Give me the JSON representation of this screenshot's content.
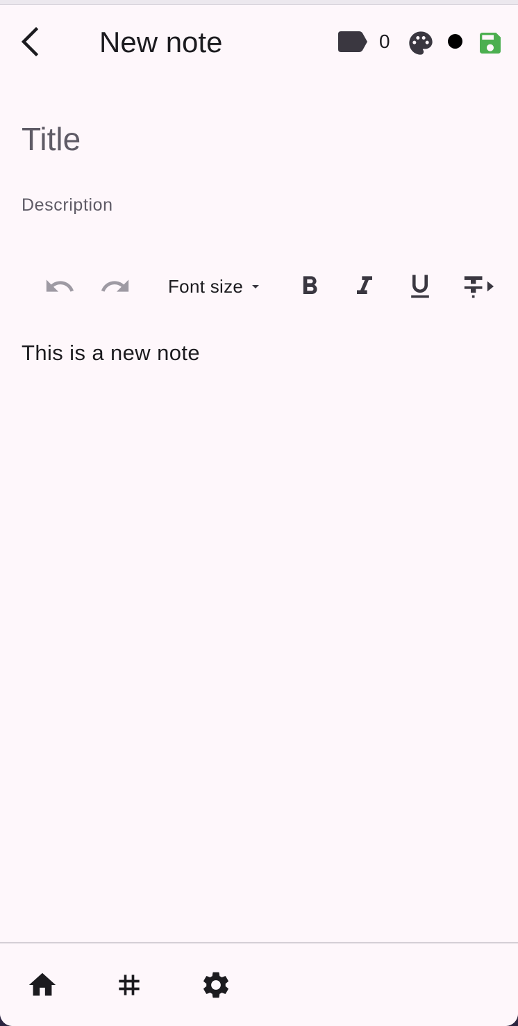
{
  "appbar": {
    "title": "New note",
    "back_icon": "chevron-left-icon",
    "tag_icon": "label-icon",
    "tag_count": "0",
    "palette_icon": "palette-icon",
    "selected_color": "#000000",
    "save_icon": "save-icon",
    "save_color": "#4caf50"
  },
  "fields": {
    "title_placeholder": "Title",
    "title_value": "",
    "description_placeholder": "Description",
    "description_value": ""
  },
  "toolbar": {
    "undo_icon": "undo-icon",
    "redo_icon": "redo-icon",
    "font_size_label": "Font size",
    "font_size_dropdown_icon": "arrow-drop-down-icon",
    "bold_icon": "format-bold-icon",
    "italic_icon": "format-italic-icon",
    "underline_icon": "format-underline-icon",
    "strikethrough_icon": "format-strikethrough-icon"
  },
  "editor": {
    "content": "This is a new note"
  },
  "bottom_nav": {
    "items": [
      {
        "icon": "home-icon"
      },
      {
        "icon": "hashtag-icon"
      },
      {
        "icon": "settings-icon"
      }
    ]
  }
}
